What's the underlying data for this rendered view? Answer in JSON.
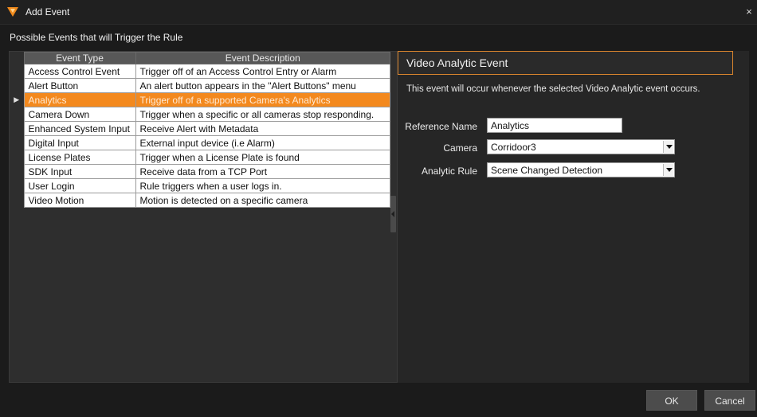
{
  "window": {
    "title": "Add Event",
    "close_label": "×"
  },
  "section_heading": "Possible Events that will Trigger the Rule",
  "table": {
    "headers": [
      "Event Type",
      "Event Description"
    ],
    "selected_marker": "▶",
    "rows": [
      {
        "type": "Access Control Event",
        "description": "Trigger off of an Access Control Entry or Alarm"
      },
      {
        "type": "Alert Button",
        "description": "An alert button appears in the \"Alert Buttons\" menu"
      },
      {
        "type": "Analytics",
        "description": "Trigger off of a supported Camera's Analytics"
      },
      {
        "type": "Camera Down",
        "description": "Trigger when a specific or all cameras stop responding."
      },
      {
        "type": "Enhanced System Input",
        "description": "Receive Alert with Metadata"
      },
      {
        "type": "Digital Input",
        "description": "External input device (i.e Alarm)"
      },
      {
        "type": "License Plates",
        "description": "Trigger when a License Plate is found"
      },
      {
        "type": "SDK Input",
        "description": "Receive data from a TCP Port"
      },
      {
        "type": "User Login",
        "description": "Rule triggers when a user logs in."
      },
      {
        "type": "Video Motion",
        "description": "Motion is detected on a specific camera"
      }
    ]
  },
  "detail": {
    "title": "Video Analytic Event",
    "description": "This event will occur whenever the selected Video Analytic event occurs.",
    "reference_name_label": "Reference Name",
    "reference_name_value": "Analytics",
    "camera_label": "Camera",
    "camera_value": "Corridoor3",
    "analytic_rule_label": "Analytic Rule",
    "analytic_rule_value": "Scene Changed Detection"
  },
  "footer": {
    "ok_label": "OK",
    "cancel_label": "Cancel"
  },
  "colors": {
    "accent": "#f3891e",
    "panel_border": "#d8842d"
  }
}
